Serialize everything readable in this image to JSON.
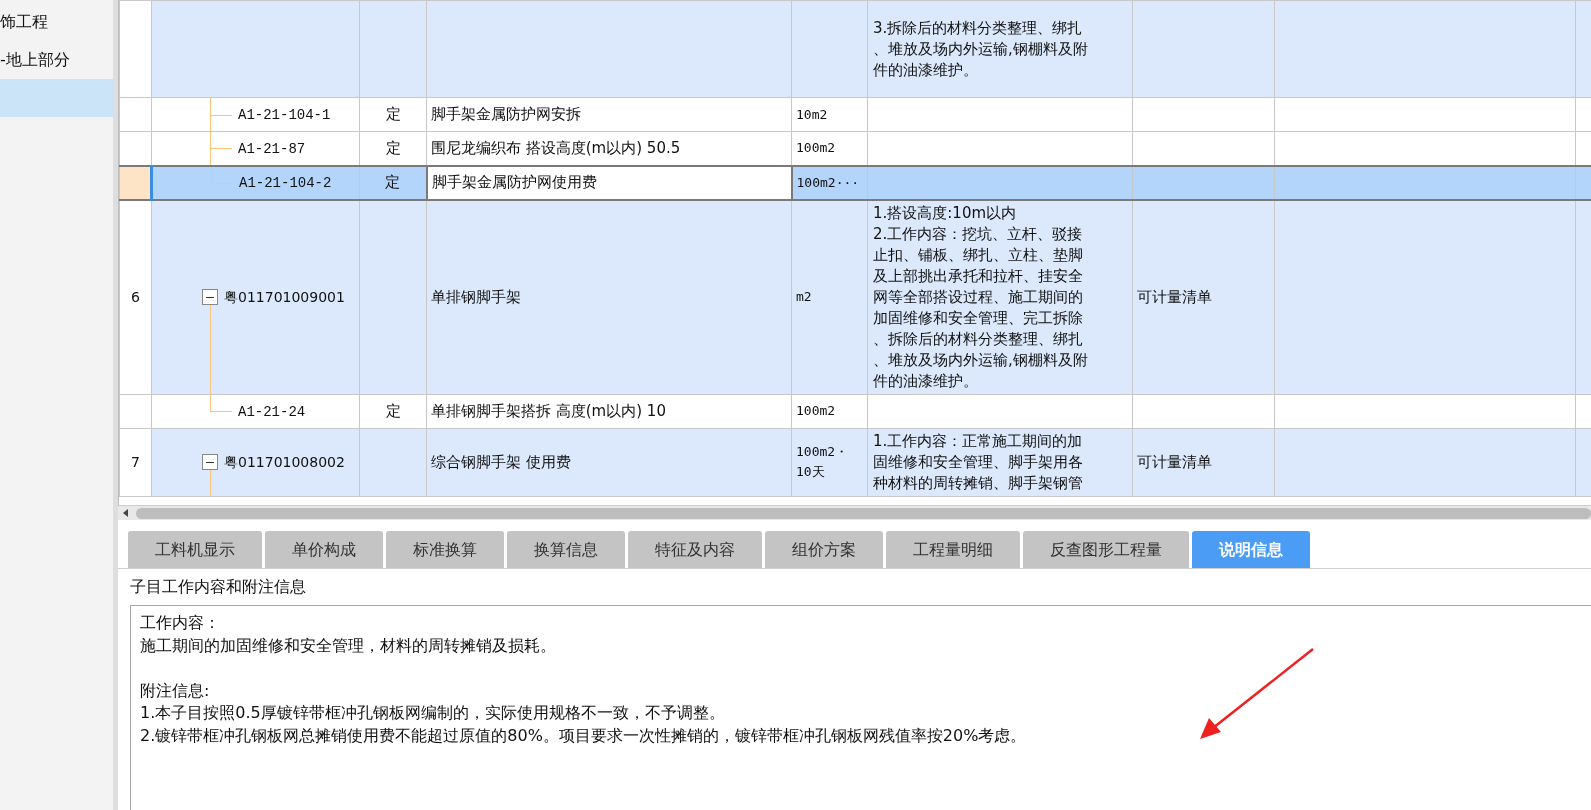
{
  "sidebar": {
    "items": [
      {
        "label": "饰工程",
        "selected": false
      },
      {
        "label": "-地上部分",
        "selected": false
      },
      {
        "selected": true
      }
    ]
  },
  "table": {
    "rows": [
      {
        "kind": "group",
        "selected": false,
        "feature": "3.拆除后的材料分类整理、绑扎、堆放及场内外运输,钢棚料及附件的油漆维护。"
      },
      {
        "kind": "item",
        "selected": false,
        "code": "A1-21-104-1",
        "type": "定",
        "name": "脚手架金属防护网安拆",
        "unit": "10m2"
      },
      {
        "kind": "item",
        "selected": false,
        "code": "A1-21-87",
        "type": "定",
        "name": "围尼龙编织布 搭设高度(m以内) 50.5",
        "unit": "100m2"
      },
      {
        "kind": "item",
        "selected": true,
        "code": "A1-21-104-2",
        "type": "定",
        "name": "脚手架金属防护网使用费",
        "unit": "100m2···"
      },
      {
        "kind": "group",
        "selected": false,
        "number": "6",
        "expanded": true,
        "code": "粤011701009001",
        "name": "单排钢脚手架",
        "unit": "m2",
        "feature": "1.搭设高度:10m以内\n2.工作内容：挖坑、立杆、驳接止扣、铺板、绑扎、立柱、垫脚及上部挑出承托和拉杆、挂安全网等全部搭设过程、施工期间的加固维修和安全管理、完工拆除、拆除后的材料分类整理、绑扎、堆放及场内外运输,钢棚料及附件的油漆维护。",
        "category": "可计量清单"
      },
      {
        "kind": "item",
        "selected": false,
        "code": "A1-21-24",
        "type": "定",
        "name": "单排钢脚手架搭拆 高度(m以内) 10",
        "unit": "100m2"
      },
      {
        "kind": "group",
        "selected": false,
        "number": "7",
        "expanded": true,
        "code": "粤011701008002",
        "name": "综合钢脚手架 使用费",
        "unit": "100m2・\n10天",
        "feature": "1.工作内容：正常施工期间的加固维修和安全管理、脚手架用各种材料的周转摊销、脚手架钢管",
        "category": "可计量清单"
      }
    ]
  },
  "tabs": [
    {
      "label": "工料机显示",
      "selected": false
    },
    {
      "label": "单价构成",
      "selected": false
    },
    {
      "label": "标准换算",
      "selected": false
    },
    {
      "label": "换算信息",
      "selected": false
    },
    {
      "label": "特征及内容",
      "selected": false
    },
    {
      "label": "组价方案",
      "selected": false
    },
    {
      "label": "工程量明细",
      "selected": false
    },
    {
      "label": "反查图形工程量",
      "selected": false
    },
    {
      "label": "说明信息",
      "selected": true
    }
  ],
  "detail_panel": {
    "title": "子目工作内容和附注信息",
    "sections": [
      {
        "lines": [
          "工作内容：",
          "施工期间的加固维修和安全管理，材料的周转摊销及损耗。"
        ]
      },
      {
        "lines": [
          "附注信息:",
          "1.本子目按照0.5厚镀锌带框冲孔钢板网编制的，实际使用规格不一致，不予调整。",
          "2.镀锌带框冲孔钢板网总摊销使用费不能超过原值的80%。项目要求一次性摊销的，镀锌带框冲孔钢板网残值率按20%考虑。"
        ]
      }
    ]
  }
}
